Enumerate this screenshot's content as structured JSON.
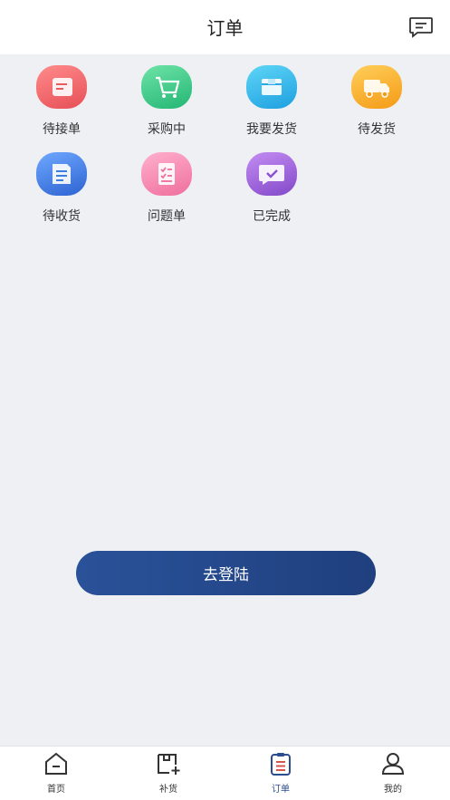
{
  "header": {
    "title": "订单"
  },
  "order_status": [
    {
      "label": "待接单",
      "icon": "order-receipt-icon",
      "color": "#f06a6a"
    },
    {
      "label": "采购中",
      "icon": "shopping-cart-icon",
      "color": "#3cc98a"
    },
    {
      "label": "我要发货",
      "icon": "box-icon",
      "color": "#2fb9ea"
    },
    {
      "label": "待发货",
      "icon": "truck-icon",
      "color": "#f7b12c"
    },
    {
      "label": "待收货",
      "icon": "receive-document-icon",
      "color": "#3b7de0"
    },
    {
      "label": "问题单",
      "icon": "problem-checklist-icon",
      "color": "#f07aa6"
    },
    {
      "label": "已完成",
      "icon": "chat-check-icon",
      "color": "#9a5fd6"
    }
  ],
  "login_button": "去登陆",
  "tabbar": {
    "items": [
      {
        "label": "首页",
        "icon": "home-icon",
        "active": false
      },
      {
        "label": "补货",
        "icon": "restock-icon",
        "active": false
      },
      {
        "label": "订单",
        "icon": "order-list-icon",
        "active": true
      },
      {
        "label": "我的",
        "icon": "profile-icon",
        "active": false
      }
    ],
    "active_color": "#2a4d8f"
  },
  "colors": {
    "accent": "#2a5299",
    "background": "#eef0f4"
  }
}
